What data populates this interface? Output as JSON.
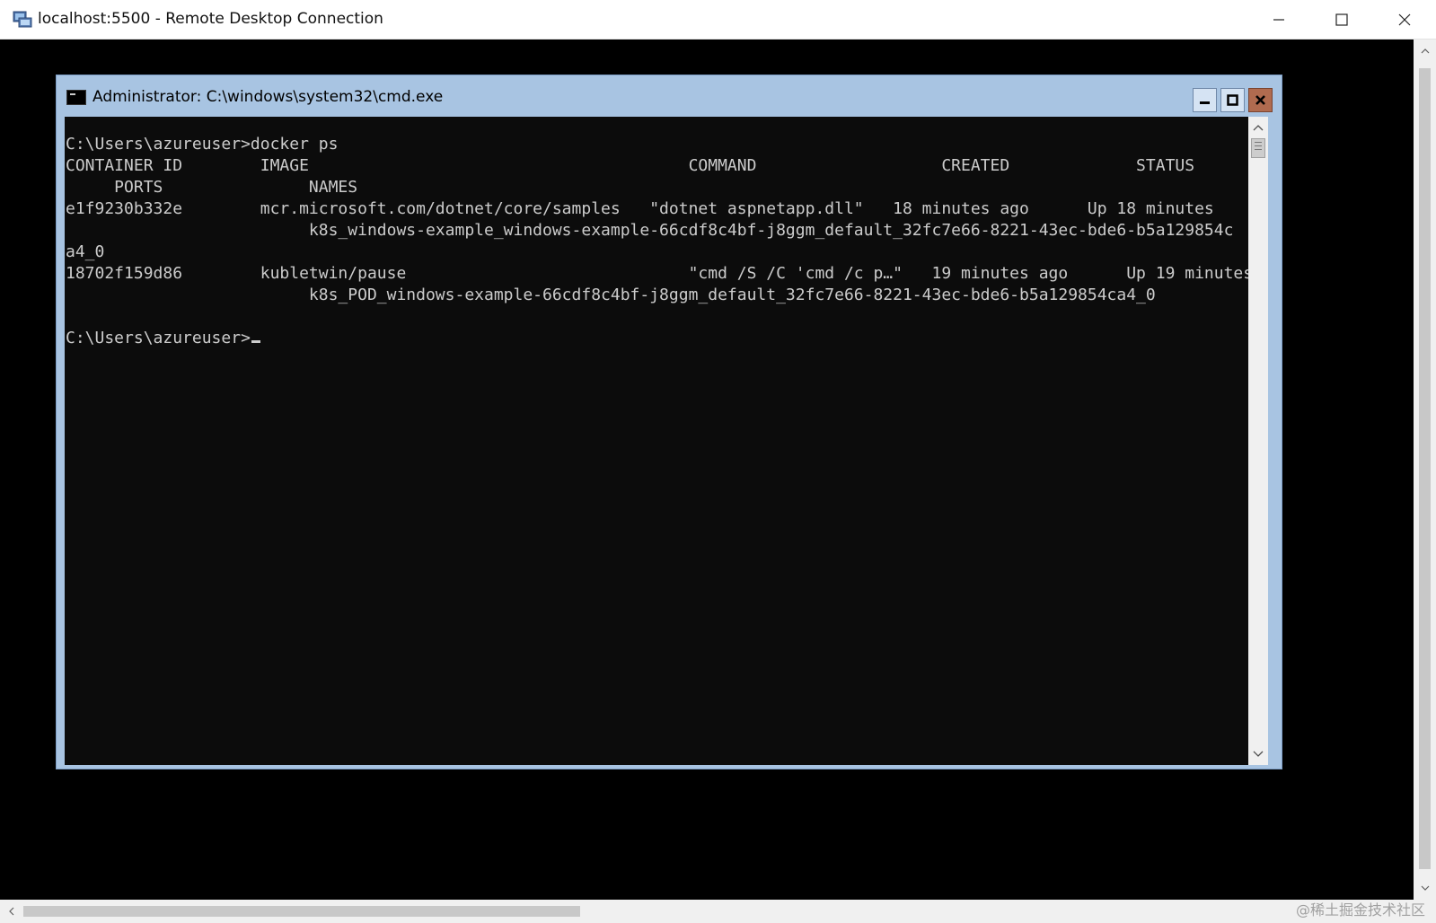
{
  "rdp": {
    "title": "localhost:5500 - Remote Desktop Connection",
    "icon": "remote-desktop-icon",
    "controls": {
      "minimize": "minimize-icon",
      "maximize": "maximize-icon",
      "close": "close-icon"
    }
  },
  "cmd": {
    "title": "Administrator: C:\\windows\\system32\\cmd.exe",
    "icon": "cmd-icon",
    "lines": [
      "C:\\Users\\azureuser>docker ps",
      "CONTAINER ID        IMAGE                                       COMMAND                   CREATED             STATUS",
      "     PORTS               NAMES",
      "e1f9230b332e        mcr.microsoft.com/dotnet/core/samples   \"dotnet aspnetapp.dll\"   18 minutes ago      Up 18 minutes",
      "                         k8s_windows-example_windows-example-66cdf8c4bf-j8ggm_default_32fc7e66-8221-43ec-bde6-b5a129854c",
      "a4_0",
      "18702f159d86        kubletwin/pause                             \"cmd /S /C 'cmd /c p…\"   19 minutes ago      Up 19 minutes",
      "                         k8s_POD_windows-example-66cdf8c4bf-j8ggm_default_32fc7e66-8221-43ec-bde6-b5a129854ca4_0",
      ""
    ],
    "prompt": "C:\\Users\\azureuser>"
  },
  "watermark": "@稀土掘金技术社区"
}
